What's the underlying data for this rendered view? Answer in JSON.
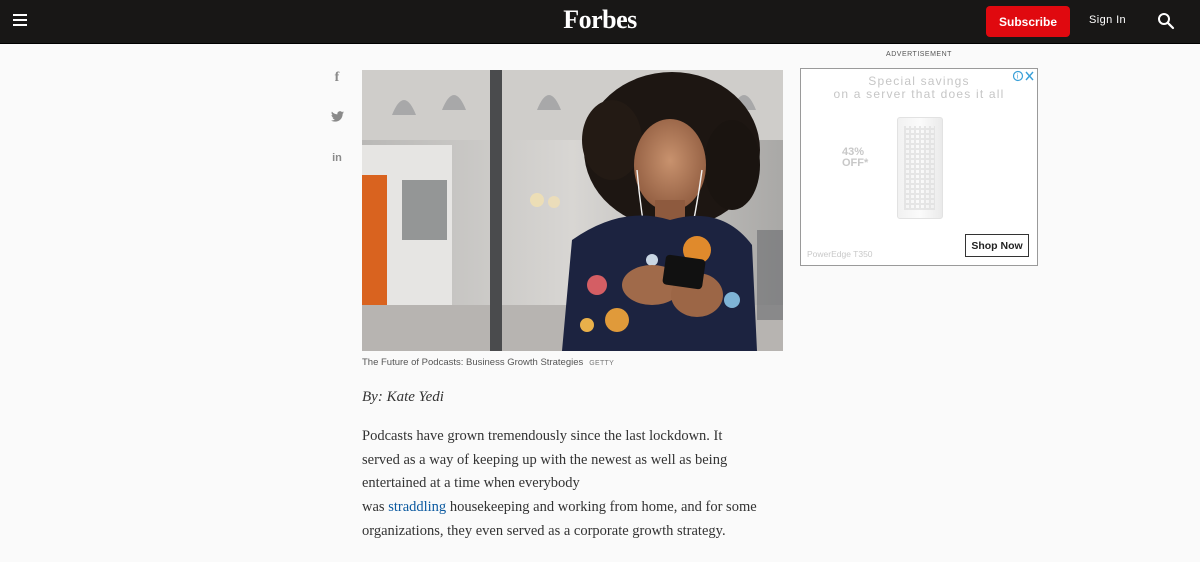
{
  "header": {
    "logo": "Forbes",
    "subscribe_label": "Subscribe",
    "signin_label": "Sign In",
    "menu_icon": "hamburger-menu-icon",
    "search_icon": "search-icon"
  },
  "share": {
    "facebook": "f",
    "twitter_icon": "twitter-icon",
    "linkedin": "in"
  },
  "hero": {
    "caption": "The Future of Podcasts: Business Growth Strategies",
    "credit": "GETTY"
  },
  "article": {
    "byline": "By: Kate Yedi",
    "paragraph_start": "Podcasts have grown tremendously since the last lockdown. It served as a way of keeping up with the newest as well as being entertained at a time when everybody",
    "was": "was",
    "link_text": "straddling",
    "paragraph_end": "housekeeping and working from home, and for some organizations, they even served as a corporate growth strategy."
  },
  "ad": {
    "label": "ADVERTISEMENT",
    "headline_1": "Special savings",
    "headline_2": "on a server that does it all",
    "discount_1": "43%",
    "discount_2": "OFF*",
    "model": "PowerEdge T350",
    "cta": "Shop Now"
  },
  "colors": {
    "topbar": "#181716",
    "subscribe": "#e0090f",
    "link": "#0c5aa0"
  }
}
